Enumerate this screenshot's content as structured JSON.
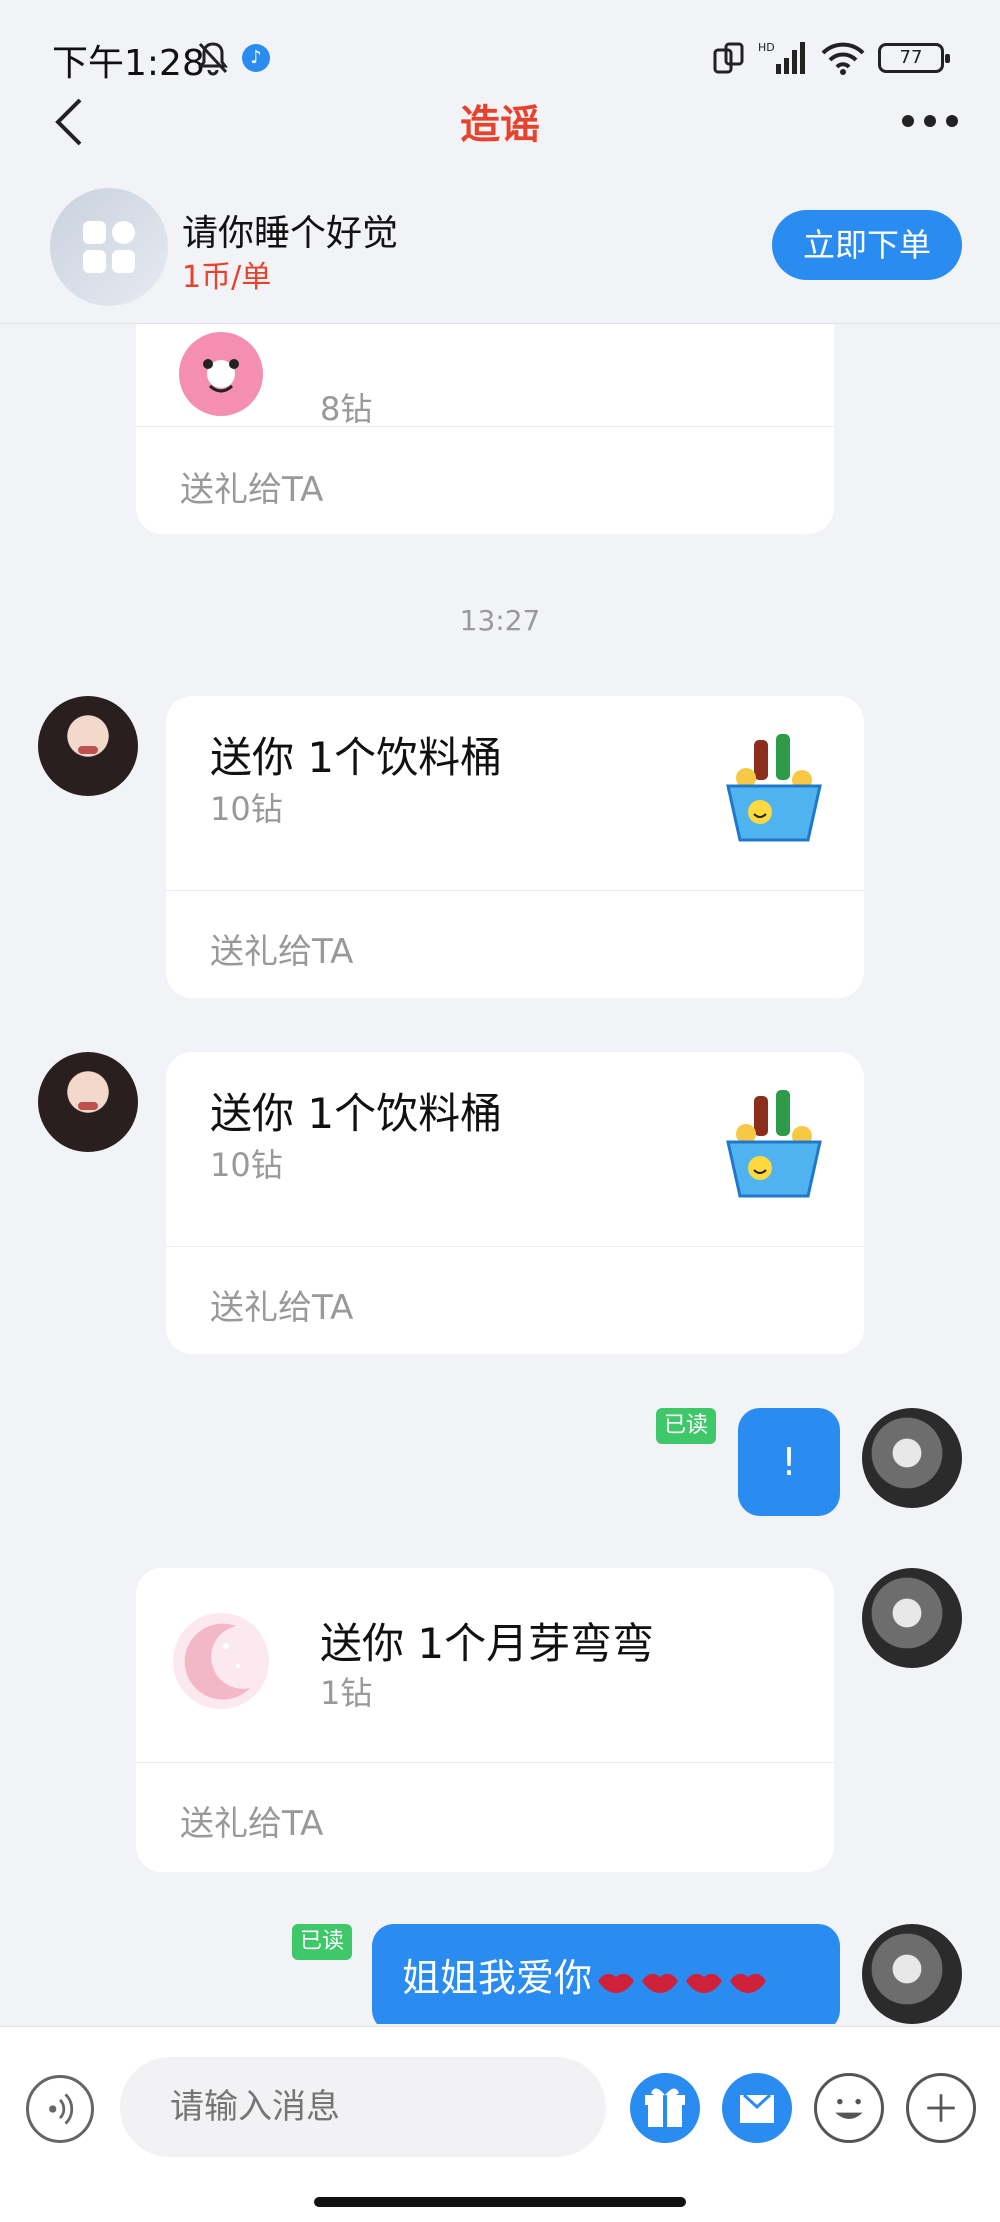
{
  "status_bar": {
    "time": "下午1:28",
    "signal_label": "HD",
    "battery": "77"
  },
  "nav": {
    "title": "造谣"
  },
  "service": {
    "name": "请你睡个好觉",
    "price": "1币/单",
    "order_label": "立即下单"
  },
  "messages": [
    {
      "type": "gift",
      "from": "me",
      "title": "",
      "price": "8钻",
      "action": "送礼给TA",
      "gift_icon": "donut-gift-icon"
    },
    {
      "type": "time",
      "text": "13:27"
    },
    {
      "type": "gift",
      "from": "her",
      "title": "送你 1个饮料桶",
      "price": "10钻",
      "action": "送礼给TA",
      "gift_icon": "drink-bucket-gift-icon"
    },
    {
      "type": "gift",
      "from": "her",
      "title": "送你 1个饮料桶",
      "price": "10钻",
      "action": "送礼给TA",
      "gift_icon": "drink-bucket-gift-icon"
    },
    {
      "type": "text",
      "from": "me",
      "text": "!",
      "read": "已读"
    },
    {
      "type": "gift",
      "from": "me",
      "title": "送你 1个月芽弯弯",
      "price": "1钻",
      "action": "送礼给TA",
      "gift_icon": "crescent-moon-gift-icon"
    },
    {
      "type": "text",
      "from": "me",
      "text": "姐姐我爱你",
      "emoji_count": 4,
      "emoji": "lips-icon",
      "read": "已读"
    }
  ],
  "input": {
    "placeholder": "请输入消息"
  },
  "colors": {
    "accent": "#2a8cf0",
    "title_red": "#e8412c",
    "read_green": "#3fc86a"
  }
}
